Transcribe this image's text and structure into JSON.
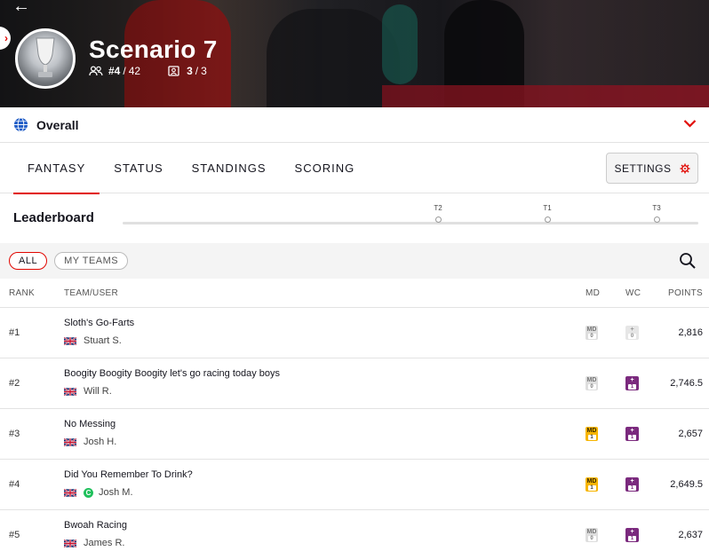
{
  "header": {
    "league_name": "Scenario 7",
    "position": "#4",
    "total_players": "42",
    "teams_used": "3",
    "teams_total": "3"
  },
  "overall": {
    "label": "Overall"
  },
  "tabs": [
    {
      "label": "FANTASY",
      "active": true
    },
    {
      "label": "STATUS",
      "active": false
    },
    {
      "label": "STANDINGS",
      "active": false
    },
    {
      "label": "SCORING",
      "active": false
    }
  ],
  "settings": {
    "label": "SETTINGS"
  },
  "leaderboard": {
    "title": "Leaderboard",
    "timeline_markers": [
      "T2",
      "T1",
      "T3"
    ]
  },
  "filters": {
    "all": "ALL",
    "my_teams": "MY TEAMS"
  },
  "table": {
    "columns": {
      "rank": "RANK",
      "team": "TEAM/USER",
      "md": "MD",
      "wc": "WC",
      "points": "POINTS"
    },
    "rows": [
      {
        "rank": "#1",
        "team": "Sloth's Go-Farts",
        "user": "Stuart S.",
        "md_label": "MD",
        "md_count": "0",
        "md_active": false,
        "wc_label": "+",
        "wc_count": "0",
        "wc_active": false,
        "badge": "",
        "points": "2,816"
      },
      {
        "rank": "#2",
        "team": "Boogity Boogity Boogity let's go racing today boys",
        "user": "Will R.",
        "md_label": "MD",
        "md_count": "0",
        "md_active": false,
        "wc_label": "+",
        "wc_count": "1",
        "wc_active": true,
        "badge": "",
        "points": "2,746.5"
      },
      {
        "rank": "#3",
        "team": "No Messing",
        "user": "Josh H.",
        "md_label": "MD",
        "md_count": "1",
        "md_active": true,
        "wc_label": "+",
        "wc_count": "1",
        "wc_active": true,
        "badge": "",
        "points": "2,657"
      },
      {
        "rank": "#4",
        "team": "Did You Remember To Drink?",
        "user": "Josh M.",
        "md_label": "MD",
        "md_count": "1",
        "md_active": true,
        "wc_label": "+",
        "wc_count": "1",
        "wc_active": true,
        "badge": "C",
        "points": "2,649.5"
      },
      {
        "rank": "#5",
        "team": "Bwoah Racing",
        "user": "James R.",
        "md_label": "MD",
        "md_count": "0",
        "md_active": false,
        "wc_label": "+",
        "wc_count": "1",
        "wc_active": true,
        "badge": "",
        "points": "2,637"
      }
    ]
  },
  "colors": {
    "accent": "#e10600",
    "wildcard": "#7b2a7e",
    "mega_driver": "#f7b500"
  }
}
